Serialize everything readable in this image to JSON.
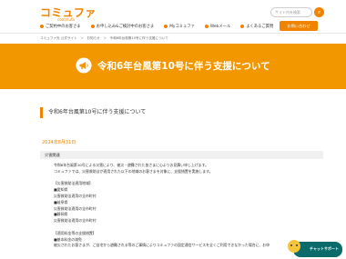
{
  "brand": {
    "logo": "コミュファ",
    "logo_sub": "commufa",
    "accent": "#f08300",
    "banner_color": "#f39700"
  },
  "search": {
    "placeholder": "サイト内を検索",
    "icon": "search-icon"
  },
  "nav": {
    "items": [
      {
        "label": "ご契約中のお客さま"
      },
      {
        "label": "お申し込み&ご検討中のお客さま"
      },
      {
        "label": "Myコミュファ"
      },
      {
        "label": "Webメール"
      },
      {
        "label": "よくあるご質問"
      }
    ],
    "contact_label": "お問い合わせ"
  },
  "breadcrumb": "コミュファ光 公式サイト　＞　お知らせ　＞　令和6年台風第10号に伴う支援について",
  "banner": {
    "title": "令和6年台風第10号に伴う支援について",
    "icon": "megaphone-icon"
  },
  "article": {
    "title": "令和6年台風第10号に伴う支援について",
    "date": "2024年8月31日",
    "category": "災害関連",
    "lines": [
      "令和6年台風第10号による災害により、被災・避難された皆さまに心よりお見舞い申し上げます。",
      "コミュファでは、災害救助法が適用された以下の地域のお客さまを対象に、支援措置を実施します。",
      "",
      "【災害救助法適用地域】",
      "■愛知県",
      "災害救助法適用の全市町村",
      "■岐阜県",
      "災害救助法適用の全市町村",
      "■静岡県",
      "災害救助法適用の全市町村",
      "",
      "【適用料金等の支援措置】",
      "■基本料金の減免",
      "被災されたお客さまが、ご自宅から避難される等のご事情によりコミュファの固定通信サービスを全くご利用できなかった場合に、お申"
    ]
  },
  "chat": {
    "label": "チャットサポート",
    "icon": "chat-avatar-icon"
  }
}
